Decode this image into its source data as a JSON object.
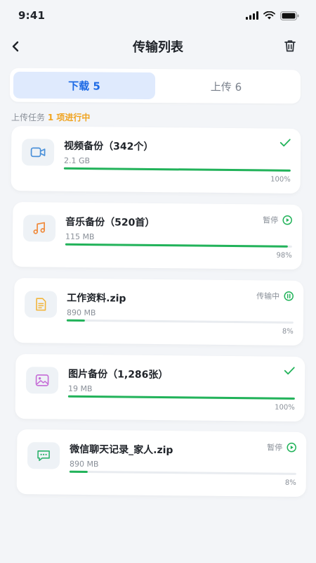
{
  "status_bar": {
    "time": "9:41"
  },
  "header": {
    "title": "传输列表"
  },
  "tabs": [
    {
      "label": "下载 5",
      "active": true
    },
    {
      "label": "上传 6",
      "active": false
    }
  ],
  "section": {
    "label": "上传任务",
    "highlight": "1 项进行中"
  },
  "colors": {
    "accent": "#1d6ae5",
    "progress": "#22b35a",
    "highlight": "#f0a31f",
    "video_icon": "#4a90d9",
    "music_icon": "#f08a3c",
    "doc_icon": "#f2b53b",
    "image_icon": "#c56bd6",
    "chat_icon": "#2fb36e"
  },
  "transfers": [
    {
      "title": "视频备份（342个）",
      "size": "2.1 GB",
      "progress": 100,
      "percent": "100%",
      "status": "",
      "status_icon": "check-icon",
      "icon": "video-icon"
    },
    {
      "title": "音乐备份（520首）",
      "size": "115 MB",
      "progress": 98,
      "percent": "98%",
      "status": "暂停",
      "status_icon": "play-icon",
      "icon": "music-icon"
    },
    {
      "title": "工作资料.zip",
      "size": "890 MB",
      "progress": 8,
      "percent": "8%",
      "status": "传输中",
      "status_icon": "pause-icon",
      "icon": "document-icon"
    },
    {
      "title": "图片备份（1,286张）",
      "size": "19 MB",
      "progress": 100,
      "percent": "100%",
      "status": "",
      "status_icon": "check-icon",
      "icon": "image-icon"
    },
    {
      "title": "微信聊天记录_家人.zip",
      "size": "890 MB",
      "progress": 8,
      "percent": "8%",
      "status": "暂停",
      "status_icon": "play-icon",
      "icon": "chat-icon"
    }
  ]
}
